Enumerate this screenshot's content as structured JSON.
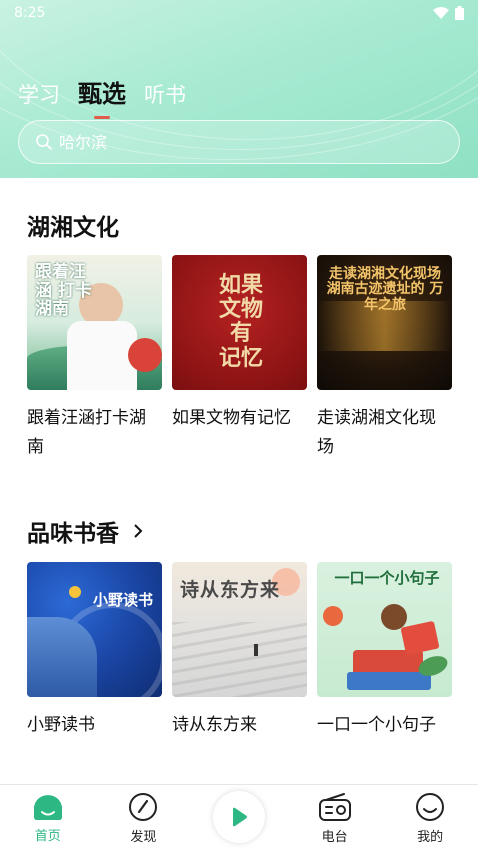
{
  "status_bar": {
    "time": "8:25"
  },
  "top_tabs": [
    {
      "label": "学习",
      "active": false
    },
    {
      "label": "甄选",
      "active": true
    },
    {
      "label": "听书",
      "active": false
    }
  ],
  "search": {
    "placeholder": "哈尔滨"
  },
  "sections": [
    {
      "title": "湖湘文化",
      "has_arrow": false,
      "items": [
        {
          "label": "跟着汪涵打卡湖南",
          "cover_text": "跟着汪涵 打卡湖南"
        },
        {
          "label": "如果文物有记忆",
          "cover_text": "如果 文物 有 记忆"
        },
        {
          "label": "走读湖湘文化现场",
          "cover_text": "走读湖湘文化现场 湖南古迹遗址的 万年之旅"
        }
      ]
    },
    {
      "title": "品味书香",
      "has_arrow": true,
      "items": [
        {
          "label": "小野读书",
          "cover_text": "小野读书"
        },
        {
          "label": "诗从东方来",
          "cover_text": "诗从东方来"
        },
        {
          "label": "一口一个小句子",
          "cover_text": "一口一个小句子"
        }
      ]
    }
  ],
  "bottom_nav": [
    {
      "label": "首页",
      "icon": "home-icon",
      "active": true
    },
    {
      "label": "发现",
      "icon": "compass-icon",
      "active": false
    },
    {
      "label": "",
      "icon": "play-icon",
      "active": false
    },
    {
      "label": "电台",
      "icon": "radio-icon",
      "active": false
    },
    {
      "label": "我的",
      "icon": "smile-icon",
      "active": false
    }
  ],
  "colors": {
    "accent": "#2db883",
    "tab_indicator": "#e35b4b",
    "header_gradient_start": "#c9f2e2",
    "header_gradient_end": "#8fe1c4"
  }
}
